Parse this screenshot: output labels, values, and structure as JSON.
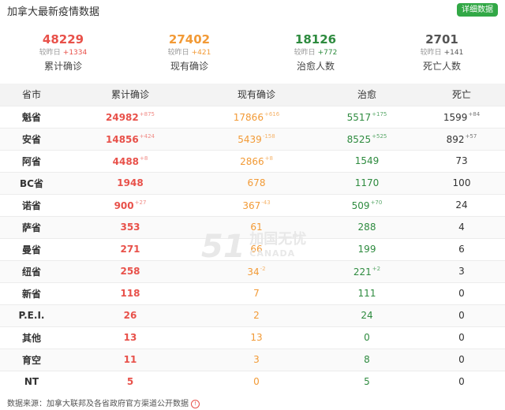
{
  "header": {
    "title": "加拿大最新疫情数据",
    "detail_button": "详细数据"
  },
  "stats": [
    {
      "value": "48229",
      "compare_label": "较昨日",
      "delta": "+1334",
      "label": "累计确诊",
      "color": "red"
    },
    {
      "value": "27402",
      "compare_label": "较昨日",
      "delta": "+421",
      "label": "现有确诊",
      "color": "orange"
    },
    {
      "value": "18126",
      "compare_label": "较昨日",
      "delta": "+772",
      "label": "治愈人数",
      "color": "green"
    },
    {
      "value": "2701",
      "compare_label": "较昨日",
      "delta": "+141",
      "label": "死亡人数",
      "color": "dark"
    }
  ],
  "table": {
    "headers": [
      "省市",
      "累计确诊",
      "现有确诊",
      "治愈",
      "死亡"
    ],
    "rows": [
      {
        "name": "魁省",
        "cum": "24982",
        "cum_d": "+875",
        "cur": "17866",
        "cur_d": "+616",
        "rec": "5517",
        "rec_d": "+175",
        "dea": "1599",
        "dea_d": "+84"
      },
      {
        "name": "安省",
        "cum": "14856",
        "cum_d": "+424",
        "cur": "5439",
        "cur_d": "-158",
        "rec": "8525",
        "rec_d": "+525",
        "dea": "892",
        "dea_d": "+57"
      },
      {
        "name": "阿省",
        "cum": "4488",
        "cum_d": "+8",
        "cur": "2866",
        "cur_d": "+8",
        "rec": "1549",
        "rec_d": "",
        "dea": "73",
        "dea_d": ""
      },
      {
        "name": "BC省",
        "cum": "1948",
        "cum_d": "",
        "cur": "678",
        "cur_d": "",
        "rec": "1170",
        "rec_d": "",
        "dea": "100",
        "dea_d": ""
      },
      {
        "name": "诺省",
        "cum": "900",
        "cum_d": "+27",
        "cur": "367",
        "cur_d": "-43",
        "rec": "509",
        "rec_d": "+70",
        "dea": "24",
        "dea_d": ""
      },
      {
        "name": "萨省",
        "cum": "353",
        "cum_d": "",
        "cur": "61",
        "cur_d": "",
        "rec": "288",
        "rec_d": "",
        "dea": "4",
        "dea_d": ""
      },
      {
        "name": "曼省",
        "cum": "271",
        "cum_d": "",
        "cur": "66",
        "cur_d": "",
        "rec": "199",
        "rec_d": "",
        "dea": "6",
        "dea_d": ""
      },
      {
        "name": "纽省",
        "cum": "258",
        "cum_d": "",
        "cur": "34",
        "cur_d": "-2",
        "rec": "221",
        "rec_d": "+2",
        "dea": "3",
        "dea_d": ""
      },
      {
        "name": "新省",
        "cum": "118",
        "cum_d": "",
        "cur": "7",
        "cur_d": "",
        "rec": "111",
        "rec_d": "",
        "dea": "0",
        "dea_d": ""
      },
      {
        "name": "P.E.I.",
        "cum": "26",
        "cum_d": "",
        "cur": "2",
        "cur_d": "",
        "rec": "24",
        "rec_d": "",
        "dea": "0",
        "dea_d": ""
      },
      {
        "name": "其他",
        "cum": "13",
        "cum_d": "",
        "cur": "13",
        "cur_d": "",
        "rec": "0",
        "rec_d": "",
        "dea": "0",
        "dea_d": ""
      },
      {
        "name": "育空",
        "cum": "11",
        "cum_d": "",
        "cur": "3",
        "cur_d": "",
        "rec": "8",
        "rec_d": "",
        "dea": "0",
        "dea_d": ""
      },
      {
        "name": "NT",
        "cum": "5",
        "cum_d": "",
        "cur": "0",
        "cur_d": "",
        "rec": "5",
        "rec_d": "",
        "dea": "0",
        "dea_d": ""
      }
    ]
  },
  "watermark": {
    "num": "51",
    "cn": "加国无忧",
    "en": "CANADA"
  },
  "footer": {
    "source": "数据来源：加拿大联邦及各省政府官方渠道公开数据"
  },
  "colors": {
    "red": "#e8514a",
    "orange": "#f29a36",
    "green": "#2e8b3f",
    "button": "#32a846"
  }
}
